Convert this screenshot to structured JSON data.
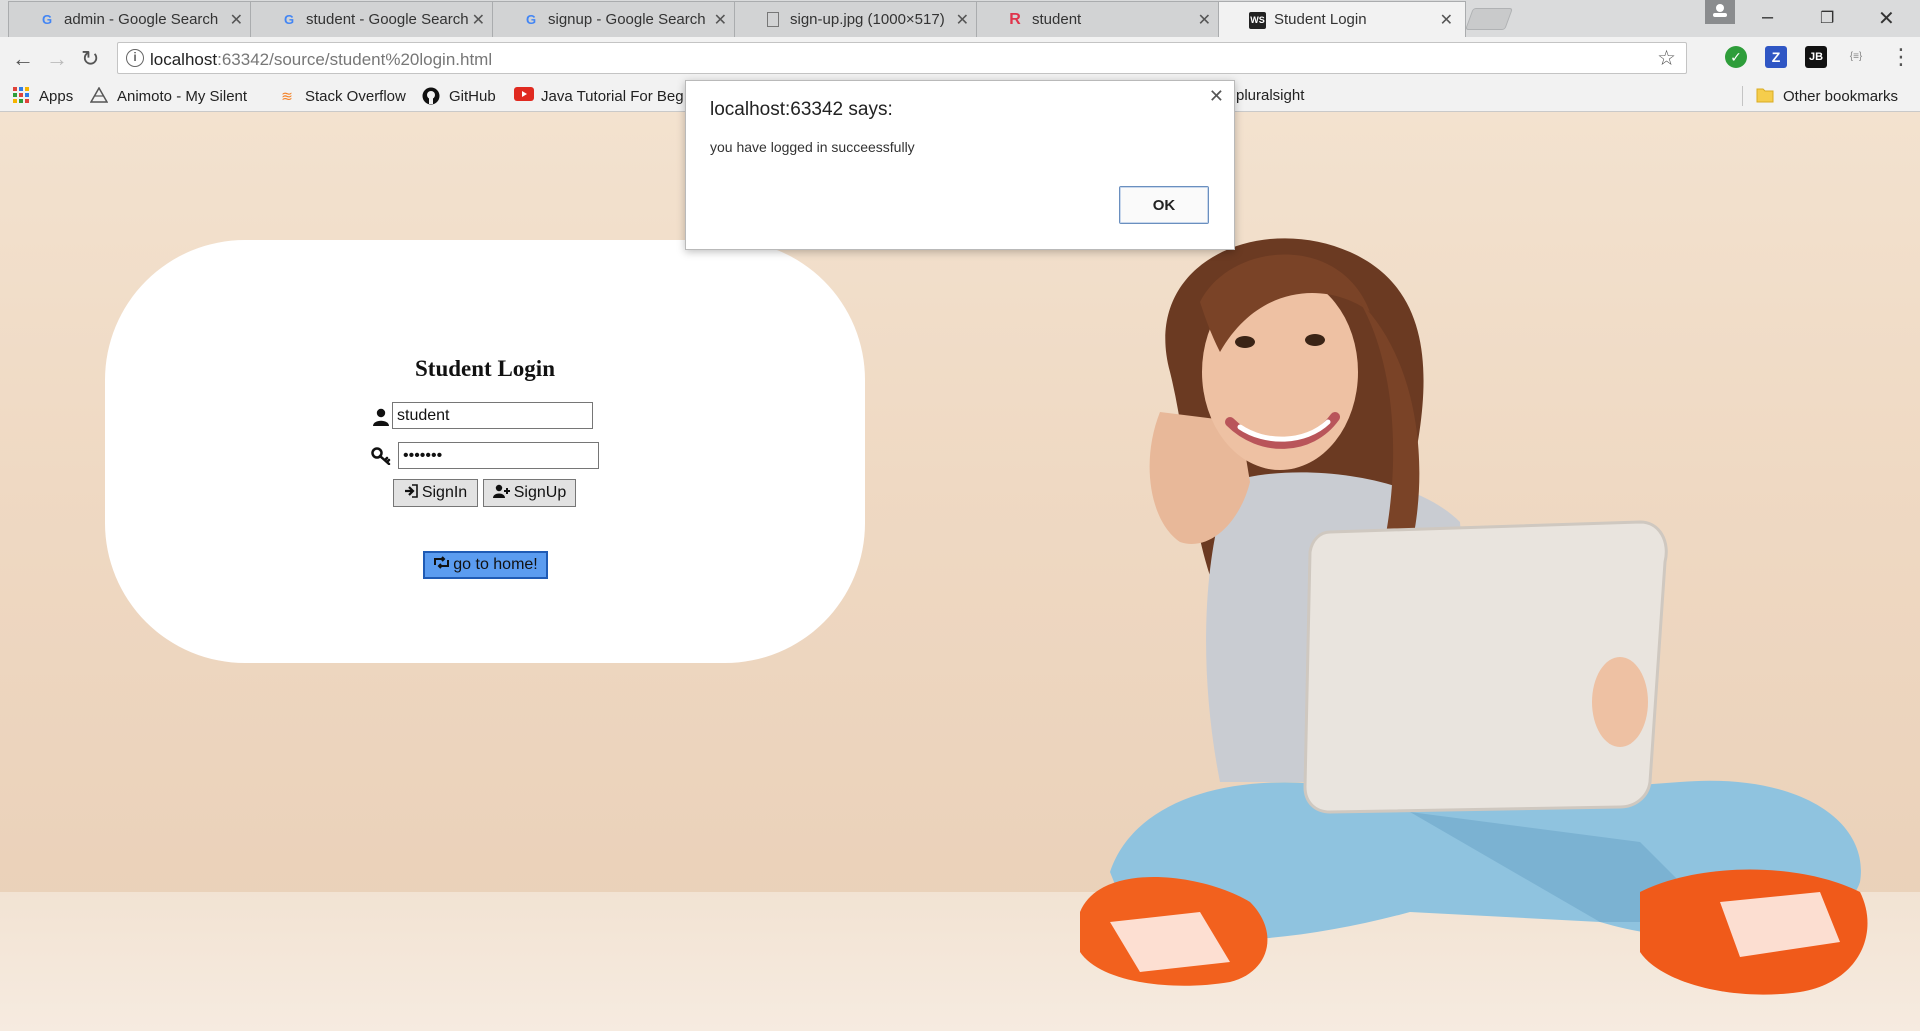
{
  "browser": {
    "tabs": [
      {
        "title": "admin - Google Search",
        "favicon": "G",
        "favicon_color": "#4285f4"
      },
      {
        "title": "student - Google Search",
        "favicon": "G",
        "favicon_color": "#4285f4"
      },
      {
        "title": "signup - Google Search",
        "favicon": "G",
        "favicon_color": "#4285f4"
      },
      {
        "title": "sign-up.jpg (1000×517)",
        "favicon": "page-icon",
        "favicon_color": "#777777"
      },
      {
        "title": "student",
        "favicon": "R",
        "favicon_color": "#e0344b"
      },
      {
        "title": "Student Login",
        "favicon": "WS",
        "favicon_color": "#222222",
        "active": true
      }
    ],
    "address": {
      "host": "localhost",
      "rest": ":63342/source/student%20login.html"
    },
    "bookmarks": [
      {
        "label": "Apps",
        "icon": "apps-grid-icon"
      },
      {
        "label": "Animoto - My Silent",
        "icon": "animoto-icon"
      },
      {
        "label": "Stack Overflow",
        "icon": "stackoverflow-icon"
      },
      {
        "label": "GitHub",
        "icon": "github-icon"
      },
      {
        "label": "Java Tutorial For Beg",
        "icon": "youtube-icon"
      },
      {
        "label": "pluralsight",
        "icon": "pluralsight-icon"
      },
      {
        "label": "Other bookmarks",
        "icon": "folder-icon"
      }
    ],
    "extensions": [
      {
        "name": "check-extension-icon",
        "glyph": "✓",
        "color": "#2e9d3a"
      },
      {
        "name": "zotero-extension-icon",
        "glyph": "Z",
        "color": "#2f56c4"
      },
      {
        "name": "jetbrains-extension-icon",
        "glyph": "JB",
        "color": "#111111"
      },
      {
        "name": "json-extension-icon",
        "glyph": "{≡}",
        "color": "#f2f2f2"
      }
    ]
  },
  "login": {
    "title": "Student Login",
    "username_value": "student",
    "password_value": "•••••••",
    "signin_label": "SignIn",
    "signup_label": "SignUp",
    "home_label": "go to home!"
  },
  "dialog": {
    "title": "localhost:63342 says:",
    "message": "you have logged in succeessfully",
    "ok_label": "OK"
  },
  "colors": {
    "home_button": "#5b9cf0",
    "page_background": "#efd9c3"
  }
}
